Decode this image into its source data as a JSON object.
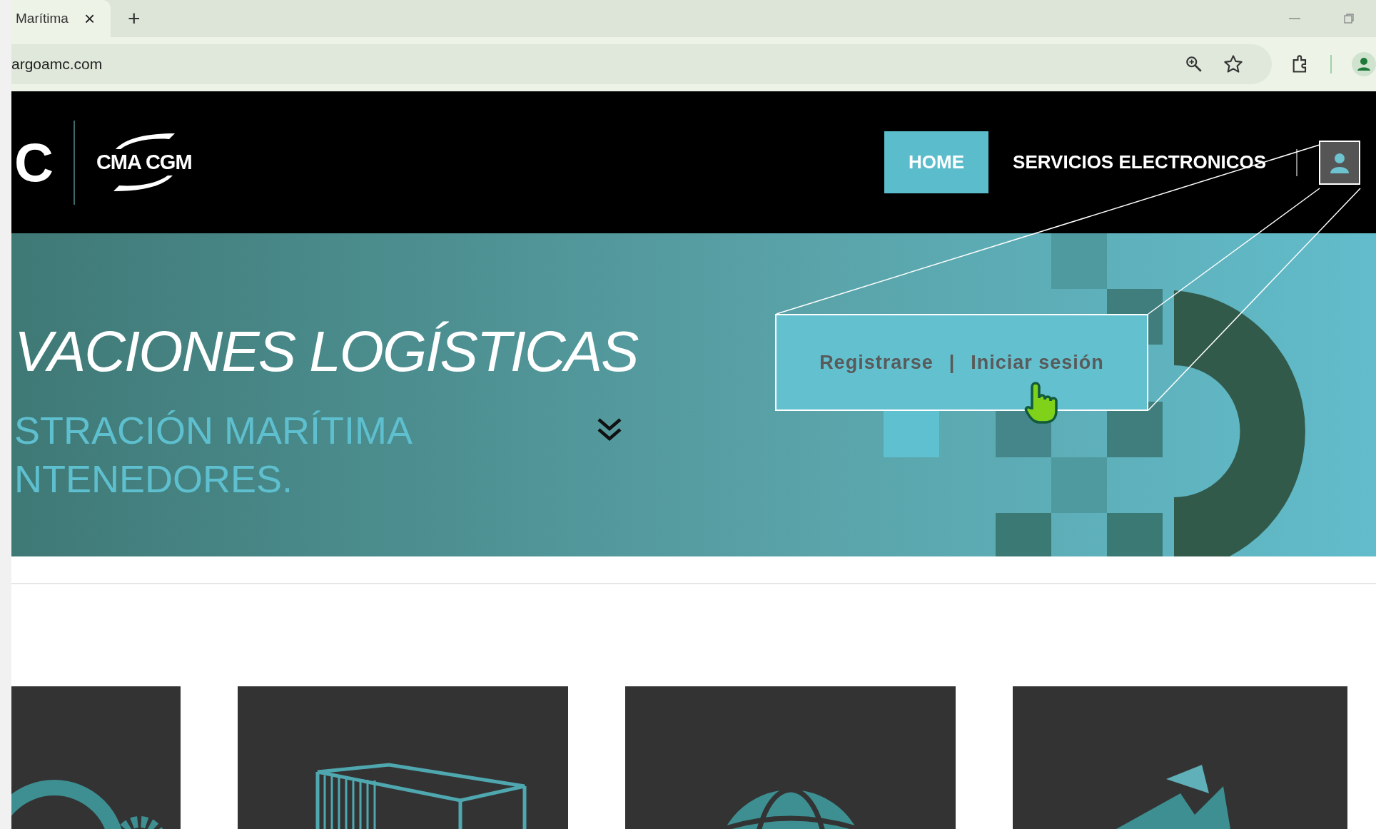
{
  "browser": {
    "tab": {
      "title": "Marítima",
      "close": "×"
    },
    "new_tab": "+",
    "url": "argoamc.com"
  },
  "header": {
    "nav": [
      {
        "label": "HOME",
        "selected": true
      },
      {
        "label": "SERVICIOS ELECTRONICOS",
        "selected": false
      }
    ],
    "logo": "CMA CGM",
    "logo_left": "C"
  },
  "hero": {
    "title": "VACIONES LOGÍSTICAS",
    "subtitle_lines": [
      "STRACIÓN MARÍTIMA",
      "NTENEDORES."
    ]
  },
  "callout": {
    "links": [
      "Registrarse",
      "Iniciar sesión"
    ],
    "separator": "|"
  },
  "cards": [
    {
      "kind": "gears"
    },
    {
      "kind": "container"
    },
    {
      "kind": "globe"
    },
    {
      "kind": "arrow"
    }
  ]
}
